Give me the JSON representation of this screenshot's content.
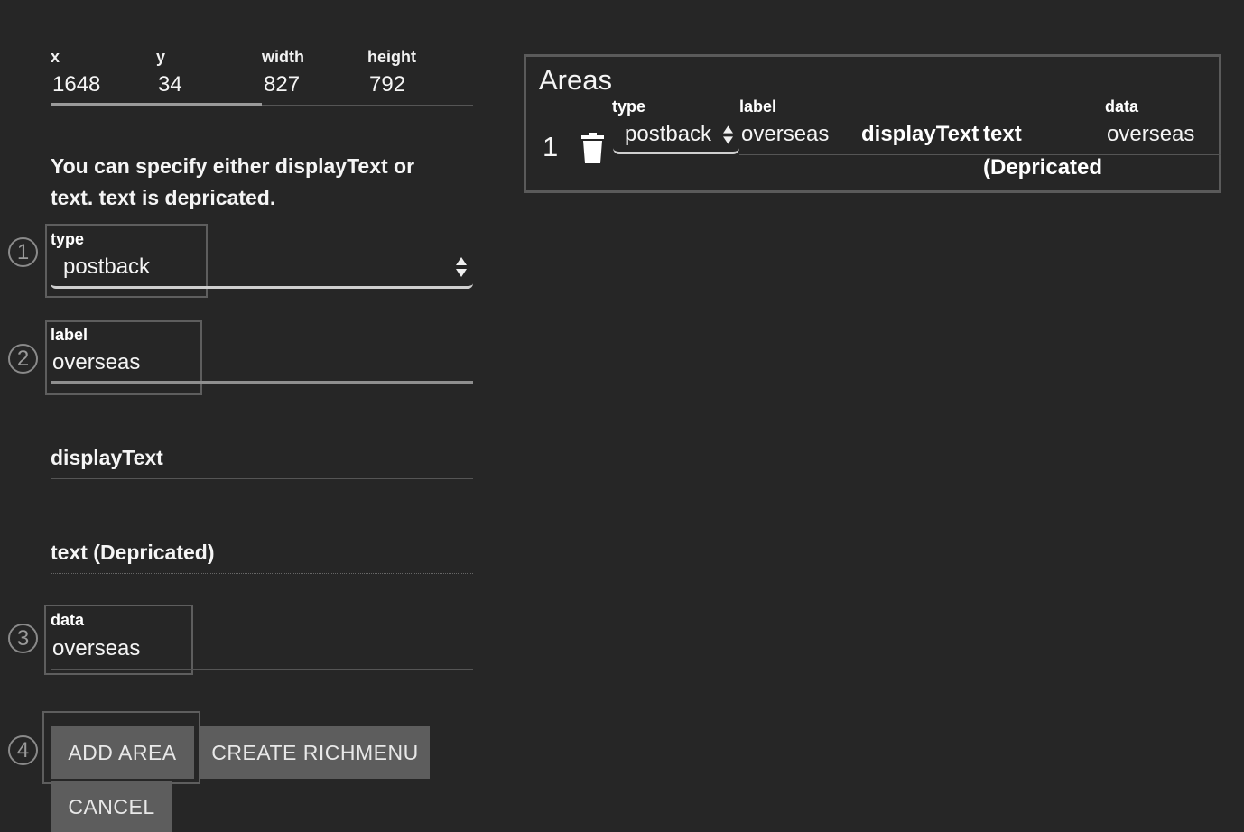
{
  "coords": {
    "x_label": "x",
    "x_value": "1648",
    "y_label": "y",
    "y_value": "34",
    "width_label": "width",
    "width_value": "827",
    "height_label": "height",
    "height_value": "792"
  },
  "notice": {
    "line1": "You can specify either displayText or",
    "line2": "text. text is depricated."
  },
  "form": {
    "type_label": "type",
    "type_value": "postback",
    "label_label": "label",
    "label_value": "overseas",
    "display_text_label": "displayText",
    "text_label": "text (Depricated)",
    "data_label": "data",
    "data_value": "overseas"
  },
  "steps": [
    "1",
    "2",
    "3",
    "4"
  ],
  "buttons": {
    "add_area": "ADD AREA",
    "create_richmenu": "CREATE RICHMENU",
    "cancel": "CANCEL"
  },
  "areas": {
    "title": "Areas",
    "col_type": "type",
    "col_label": "label",
    "col_display_text": "displayText",
    "col_text": "text",
    "col_text_suffix": "(Depricated",
    "col_data": "data",
    "rows": [
      {
        "index": "1",
        "type": "postback",
        "label": "overseas",
        "data": "overseas"
      }
    ]
  },
  "icons": {
    "trash": "trash-icon",
    "select_arrows": "updown-arrows-icon"
  }
}
